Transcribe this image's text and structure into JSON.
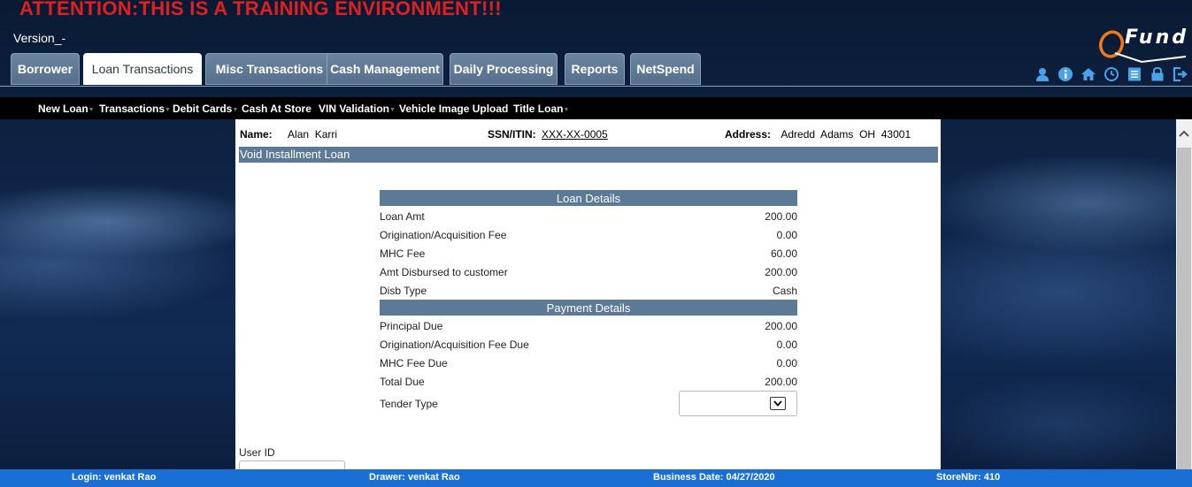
{
  "banner": "ATTENTION:THIS IS A TRAINING ENVIRONMENT!!!",
  "version": "Version_-",
  "logo": {
    "text": "Fund",
    "mark": "Q"
  },
  "tabs": [
    {
      "label": "Borrower"
    },
    {
      "label": "Loan Transactions",
      "active": true
    },
    {
      "label": "Misc Transactions"
    },
    {
      "label": "Cash Management"
    },
    {
      "label": "Daily Processing"
    },
    {
      "label": "Reports"
    },
    {
      "label": "NetSpend"
    }
  ],
  "header_icons": [
    "user-icon",
    "info-icon",
    "home-icon",
    "clock-icon",
    "list-icon",
    "lock-icon",
    "logout-icon"
  ],
  "submenu": [
    {
      "label": "New Loan"
    },
    {
      "label": "Transactions"
    },
    {
      "label": "Debit Cards"
    },
    {
      "label": "Cash At Store"
    },
    {
      "label": "VIN Validation"
    },
    {
      "label": "Vehicle Image Upload"
    },
    {
      "label": "Title Loan"
    }
  ],
  "customer": {
    "name_label": "Name:",
    "name": "Alan  Karri",
    "ssn_label": "SSN/ITIN:",
    "ssn": "XXX-XX-0005",
    "address_label": "Address:",
    "address": "Adredd  Adams  OH  43001"
  },
  "page_title": "Void Installment Loan",
  "loan_details": {
    "header": "Loan Details",
    "rows": [
      {
        "label": "Loan Amt",
        "value": "200.00"
      },
      {
        "label": "Origination/Acquisition Fee",
        "value": "0.00"
      },
      {
        "label": "MHC Fee",
        "value": "60.00"
      },
      {
        "label": "Amt Disbursed to customer",
        "value": "200.00"
      },
      {
        "label": "Disb Type",
        "value": "Cash"
      }
    ]
  },
  "payment_details": {
    "header": "Payment Details",
    "rows": [
      {
        "label": "Principal Due",
        "value": "200.00"
      },
      {
        "label": "Origination/Acquisition Fee Due",
        "value": "0.00"
      },
      {
        "label": "MHC Fee Due",
        "value": "0.00"
      },
      {
        "label": "Total Due",
        "value": "200.00"
      }
    ]
  },
  "tender": {
    "label": "Tender Type",
    "value": ""
  },
  "user_id": {
    "label": "User ID",
    "value": ""
  },
  "footer": {
    "login": "Login: venkat Rao",
    "drawer": "Drawer: venkat Rao",
    "business_date": "Business Date: 04/27/2020",
    "store": "StoreNbr: 410"
  },
  "colors": {
    "banner": "#e02020",
    "tab": "#5f7893",
    "section_bar": "#5c7a96",
    "footer": "#1a6fd4",
    "icon": "#4aa3e8"
  }
}
